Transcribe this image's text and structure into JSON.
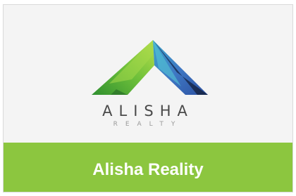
{
  "logo": {
    "icon": "pyramid-icon",
    "brand_word": "ALISHA",
    "brand_sub": "REALTY",
    "colors": [
      "#8cc63f",
      "#2a9fb8",
      "#3f6fb8",
      "#1b2a55"
    ]
  },
  "banner": {
    "title": "Alisha Reality",
    "color": "#8cc63f"
  }
}
